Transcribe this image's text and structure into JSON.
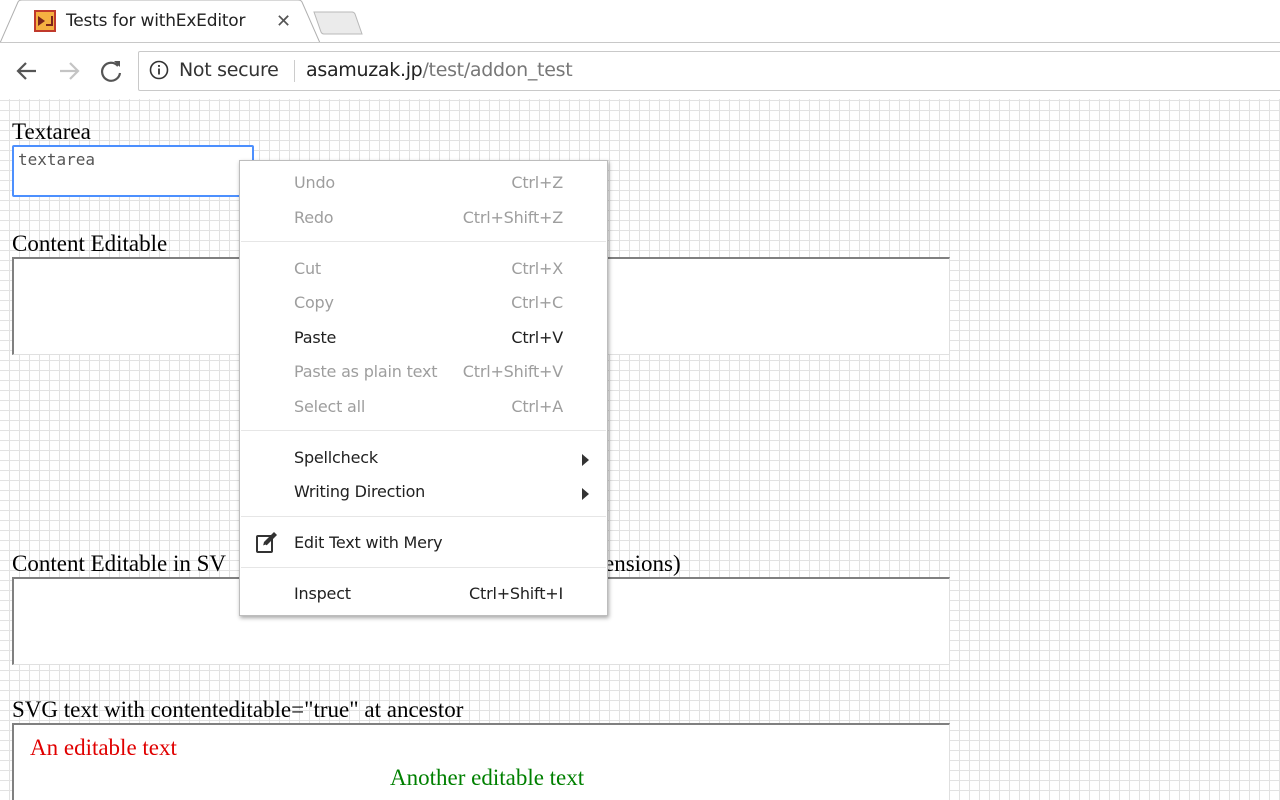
{
  "browser": {
    "tab_title": "Tests for withExEditor",
    "tab_close": "✕",
    "security_label": "Not secure",
    "url_host": "asamuzak.jp",
    "url_path": "/test/addon_test"
  },
  "page": {
    "textarea_heading": "Textarea",
    "textarea_value": "textarea",
    "content_editable_heading": "Content Editable",
    "svg_ce_heading_left": "Content Editable in SV",
    "svg_ce_heading_right": "ensions)",
    "svg_text_heading": "SVG text with contenteditable=\"true\" at ancestor",
    "svg_text_1": "An editable text",
    "svg_text_2": "Another editable text"
  },
  "context_menu": {
    "undo": {
      "label": "Undo",
      "shortcut": "Ctrl+Z"
    },
    "redo": {
      "label": "Redo",
      "shortcut": "Ctrl+Shift+Z"
    },
    "cut": {
      "label": "Cut",
      "shortcut": "Ctrl+X"
    },
    "copy": {
      "label": "Copy",
      "shortcut": "Ctrl+C"
    },
    "paste": {
      "label": "Paste",
      "shortcut": "Ctrl+V"
    },
    "paste_plain": {
      "label": "Paste as plain text",
      "shortcut": "Ctrl+Shift+V"
    },
    "select_all": {
      "label": "Select all",
      "shortcut": "Ctrl+A"
    },
    "spellcheck": {
      "label": "Spellcheck"
    },
    "writing_direction": {
      "label": "Writing Direction"
    },
    "edit_mery": {
      "label": "Edit Text with Mery"
    },
    "inspect": {
      "label": "Inspect",
      "shortcut": "Ctrl+Shift+I"
    }
  },
  "colors": {
    "focus_border": "#4d90fe",
    "svg_text_red": "#e00000",
    "svg_text_green": "#008000"
  }
}
